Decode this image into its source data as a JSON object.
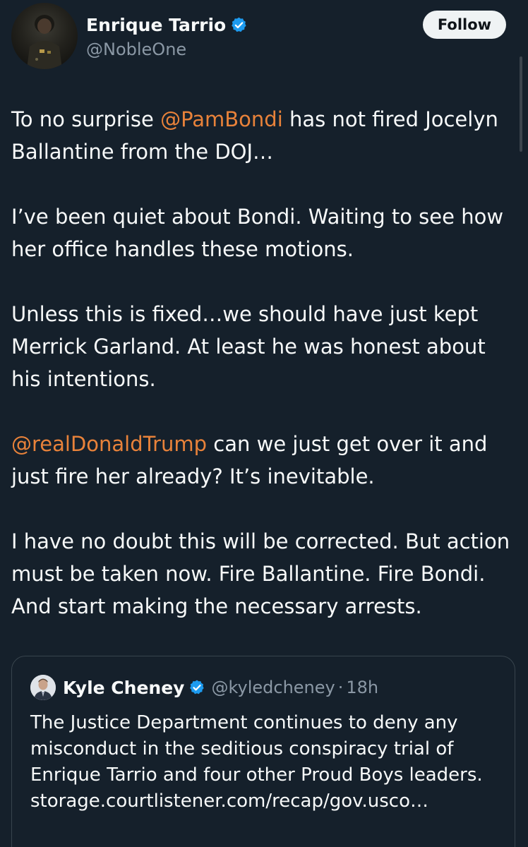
{
  "tweet": {
    "author": {
      "name": "Enrique Tarrio",
      "handle": "@NobleOne",
      "avatar_icon": "profile-photo"
    },
    "follow_label": "Follow",
    "paragraphs": [
      [
        {
          "text": "To no surprise ",
          "mention": false
        },
        {
          "text": "@PamBondi",
          "mention": true
        },
        {
          "text": " has not fired Jocelyn Ballantine from the DOJ…",
          "mention": false
        }
      ],
      [
        {
          "text": "I’ve been quiet about Bondi. Waiting to see how her office handles these motions.",
          "mention": false
        }
      ],
      [
        {
          "text": "Unless this is fixed…we should have just kept Merrick Garland. At least he was honest about his intentions.",
          "mention": false
        }
      ],
      [
        {
          "text": "@realDonaldTrump",
          "mention": true
        },
        {
          "text": " can we just get over it and just fire her already? It’s inevitable.",
          "mention": false
        }
      ],
      [
        {
          "text": "I have no doubt this will be corrected. But action must be taken now. Fire Ballantine. Fire Bondi. And start making the necessary arrests.",
          "mention": false
        }
      ]
    ]
  },
  "quoted_tweet": {
    "name": "Kyle Cheney",
    "handle": "@kyledcheney",
    "separator": "·",
    "time": "18h",
    "text": "The Justice Department continues to deny any misconduct in the seditious conspiracy trial of Enrique Tarrio and four other Proud Boys leaders. storage.courtlistener.com/recap/gov.usco…"
  },
  "colors": {
    "background": "#15202b",
    "text": "#f7f9f9",
    "secondary_text": "#8b98a5",
    "mention": "#e8823a",
    "verified_badge": "#1d9bf0",
    "follow_button_bg": "#eff3f4"
  }
}
